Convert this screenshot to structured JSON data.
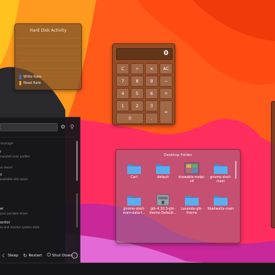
{
  "hdd_widget": {
    "title": "Hard Disk Activity",
    "legend": [
      {
        "label": "Write Rate",
        "color": "#3b6fe0"
      },
      {
        "label": "Read Rate",
        "color": "#f0a030"
      }
    ]
  },
  "calculator": {
    "display": "0",
    "keys": [
      "C",
      "÷",
      "×",
      "AC",
      "7",
      "8",
      "9",
      "−",
      "4",
      "5",
      "6",
      "+",
      "1",
      "2",
      "3",
      "=",
      "0",
      "."
    ]
  },
  "desktop_folder": {
    "title": "Desktop Folder",
    "items": [
      {
        "label": "Carl",
        "icon": "folder-icon"
      },
      {
        "label": "default",
        "icon": "folder-icon"
      },
      {
        "label": "drawable-nodpi-v4",
        "icon": "image-folder-icon"
      },
      {
        "label": "gnome-shell-main",
        "icon": "folder-icon"
      },
      {
        "label": "gnome-shell-main-data-t...",
        "icon": "folder-icon"
      },
      {
        "label": "gtk-4.10.3-gtk-theme-Default...",
        "icon": "archive-icon"
      },
      {
        "label": "Lavanda-gtk-theme",
        "icon": "folder-icon"
      },
      {
        "label": "libadwaita-main",
        "icon": "folder-icon"
      }
    ]
  },
  "launcher": {
    "list": [
      {
        "title": "",
        "sub": "rmanager"
      },
      {
        "title": "r",
        "sub": "mulated color profiles"
      },
      {
        "title": "",
        "sub": "ur disord"
      },
      {
        "title": "y",
        "sub": "available disk space"
      },
      {
        "title": "er",
        "sub": "your portable drives"
      },
      {
        "title": "onitor",
        "sub": "es and monitor system state"
      }
    ],
    "power": [
      {
        "label": "Sleep",
        "icon": "sleep-icon"
      },
      {
        "label": "Restart",
        "icon": "restart-icon"
      },
      {
        "label": "Shut Down",
        "icon": "power-icon"
      }
    ]
  },
  "colors": {
    "accent": "#ff6a1f",
    "folder_blue": "#4fa3e8"
  }
}
